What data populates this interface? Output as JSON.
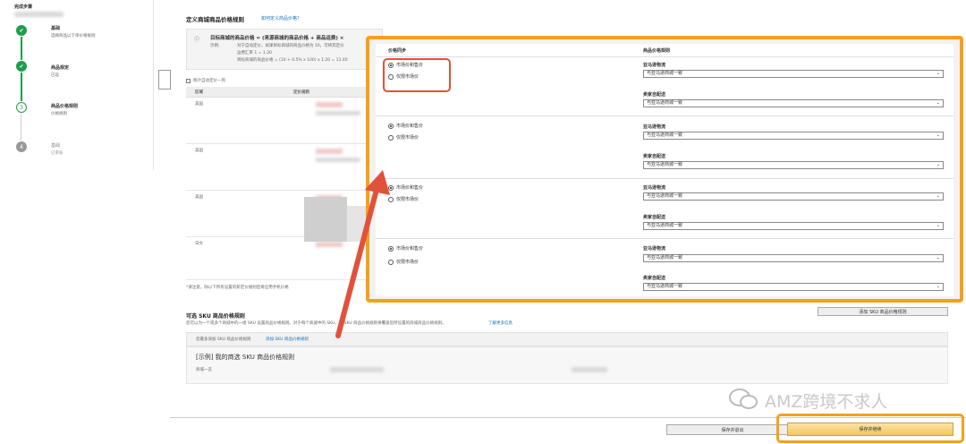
{
  "sidebar": {
    "header": "完成步骤",
    "steps": [
      {
        "title": "基础",
        "sub": "选择商品以下单价格规则"
      },
      {
        "title": "商品规定",
        "sub": "已设"
      },
      {
        "title": "商品价格规则",
        "sub": "价格规则"
      },
      {
        "title": "基础",
        "sub": "已审核"
      }
    ],
    "step_numbers": [
      "✔",
      "✔",
      "3",
      "4"
    ]
  },
  "main": {
    "section_title": "定义商城商品价格规则",
    "section_link": "如何定义商品价格？",
    "formula": "目标商城的商品价格 = (来源商城的商品价格 + 商品运费) ×",
    "formula_label": "示例:",
    "formula_lines": [
      "对于自动定价，如果目标商城的商品价格为 10，可将其定价",
      "运费汇率 1 = 1.20",
      "目标商城的商品价格 = (10 + 0.5% x 100) x 1.20 = 11.40"
    ],
    "checkbox_label": "统计自动定价一到",
    "table_headers": [
      "区域",
      "定价规则"
    ],
    "rows": [
      "美国",
      "美国",
      "美国",
      "日文"
    ],
    "footnote": "*请注意，除以下所有设置的新定价规则后将应用手机价格",
    "sku_title": "可选 SKU 商品价格规则",
    "sku_desc": "您可以为一个或多个商城中的一组 SKU 设置商品价格规则。对于每个商城中的 SKU，该 SKU 商品价格规则将覆盖您所设置的商城商品价格规则。",
    "sku_link": "了解更多信息",
    "sku_bar": "您最多添加 SKU 商品价格规则",
    "sku_bar_link": "添加 SKU 商品价格规则",
    "sku_example_title": "[示例] 我的商选 SKU 商品价格规则",
    "sku_example_sub": "商城一览",
    "add_sku_button": "添加 SKU 商品价格规则"
  },
  "popup": {
    "col1_header": "价格同步",
    "col2_header": "商品价格规则",
    "option_sync": "市场价和售价",
    "option_list": "仅限市场价",
    "label_fba": "亚马逊物流",
    "label_fbm": "卖家自配送",
    "select_value": "与亚马逊商城一致"
  },
  "footer": {
    "save_exit": "保存并退出",
    "save_continue": "保存并继续"
  },
  "watermark": "AMZ跨境不求人",
  "colors": {
    "orange": "#f5a01a",
    "red": "#e0523b",
    "green": "#1e9e4a"
  }
}
